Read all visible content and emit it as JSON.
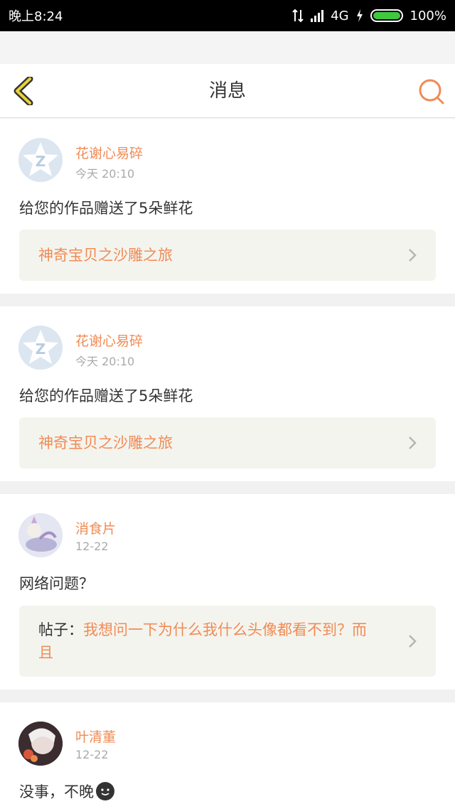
{
  "status_bar": {
    "time": "晚上8:24",
    "network": "4G",
    "battery": "100%"
  },
  "header": {
    "title": "消息"
  },
  "messages": [
    {
      "user": "花谢心易碎",
      "time": "今天 20:10",
      "text": "给您的作品赠送了5朵鲜花",
      "link_prefix": "",
      "link": "神奇宝贝之沙雕之旅"
    },
    {
      "user": "花谢心易碎",
      "time": "今天 20:10",
      "text": "给您的作品赠送了5朵鲜花",
      "link_prefix": "",
      "link": "神奇宝贝之沙雕之旅"
    },
    {
      "user": "消食片",
      "time": "12-22",
      "text": "网络问题？",
      "link_prefix": "帖子：",
      "link": "我想问一下为什么我什么头像都看不到？而且"
    },
    {
      "user": "叶清董",
      "time": "12-22",
      "text": "没事，不晚"
    }
  ],
  "colors": {
    "accent": "#f08b55",
    "back_icon": "#e8d33a",
    "link_box_bg": "#f4f4ee"
  }
}
